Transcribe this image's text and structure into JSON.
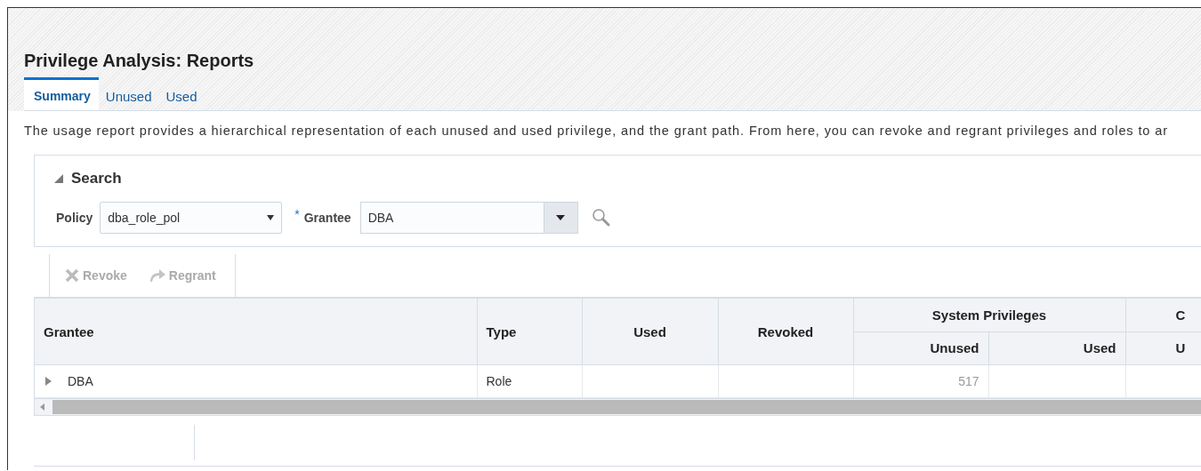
{
  "page": {
    "title": "Privilege Analysis: Reports"
  },
  "tabs": [
    {
      "label": "Summary",
      "selected": true
    },
    {
      "label": "Unused",
      "selected": false
    },
    {
      "label": "Used",
      "selected": false
    }
  ],
  "description": "The usage report provides a hierarchical representation of each unused and used privilege, and the grant path. From here, you can revoke and regrant privileges and roles to ar",
  "search": {
    "title": "Search",
    "expanded": true,
    "policy": {
      "label": "Policy",
      "value": "dba_role_pol"
    },
    "grantee": {
      "label": "Grantee",
      "required": true,
      "required_mark": "*",
      "value": "DBA"
    }
  },
  "toolbar": [
    {
      "kind": "revoke",
      "label": "Revoke",
      "disabled": true
    },
    {
      "kind": "regrant",
      "label": "Regrant",
      "disabled": true
    }
  ],
  "table": {
    "columns": [
      "Grantee",
      "Type",
      "Used",
      "Revoked"
    ],
    "group": {
      "label": "System Privileges",
      "subcolumns": [
        "Unused",
        "Used"
      ]
    },
    "cut_group": {
      "label": "C",
      "subcolumn": "U"
    },
    "rows": [
      {
        "grantee": "DBA",
        "expanded": false,
        "type": "Role",
        "sys_unused": "517"
      }
    ]
  }
}
